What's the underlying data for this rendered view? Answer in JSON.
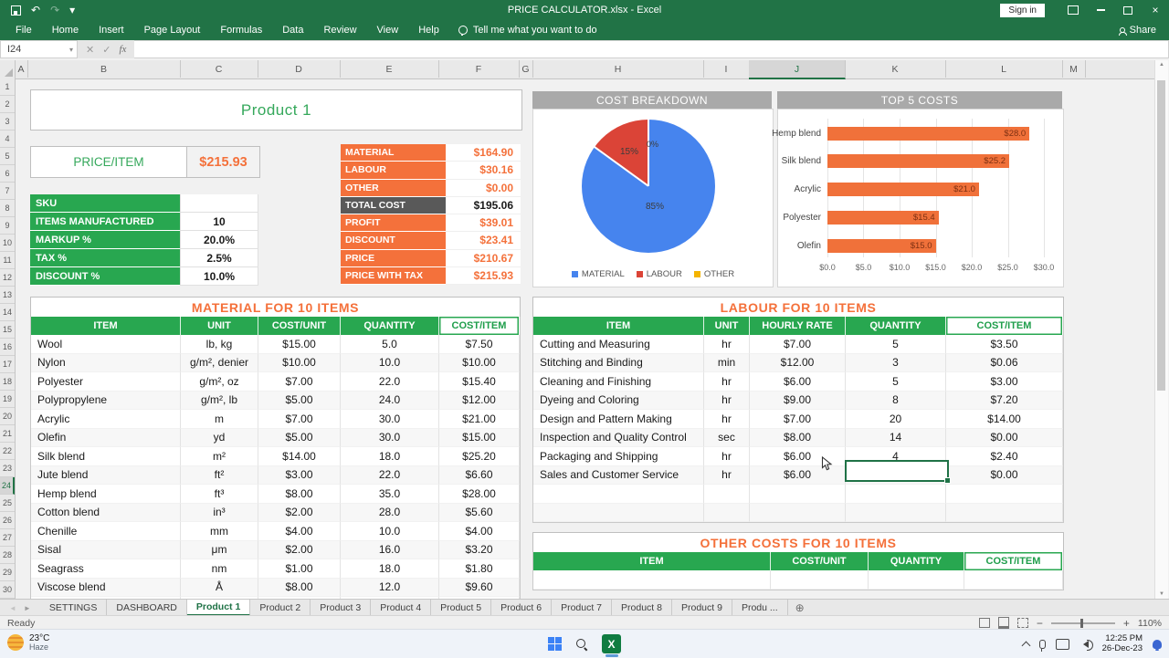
{
  "titlebar": {
    "title": "PRICE CALCULATOR.xlsx - Excel",
    "sign_in": "Sign in",
    "share": "Share"
  },
  "ribbon": {
    "tabs": [
      {
        "label": "File"
      },
      {
        "label": "Home"
      },
      {
        "label": "Insert"
      },
      {
        "label": "Page Layout"
      },
      {
        "label": "Formulas"
      },
      {
        "label": "Data"
      },
      {
        "label": "Review"
      },
      {
        "label": "View"
      },
      {
        "label": "Help"
      }
    ],
    "tell_me": "Tell me what you want to do"
  },
  "formula_bar": {
    "name_box": "I24",
    "fx": "fx"
  },
  "icons": {
    "undo": "↶",
    "redo": "↷",
    "dropdown": "▾",
    "close": "×",
    "check": "✓",
    "cancel": "✕",
    "up": "▲",
    "down": "▼",
    "prev": "◄",
    "next": "►",
    "new_sheet": "⊕",
    "minus": "−",
    "plus": "+"
  },
  "grid": {
    "columns": [
      {
        "label": "A"
      },
      {
        "label": "B"
      },
      {
        "label": "C"
      },
      {
        "label": "D"
      },
      {
        "label": "E"
      },
      {
        "label": "F"
      },
      {
        "label": "G"
      },
      {
        "label": "H"
      },
      {
        "label": "I"
      },
      {
        "label": "J",
        "class": "sel"
      },
      {
        "label": "K"
      },
      {
        "label": "L"
      },
      {
        "label": "M"
      }
    ],
    "rows": [
      {
        "label": "1"
      },
      {
        "label": "2"
      },
      {
        "label": "3"
      },
      {
        "label": "4"
      },
      {
        "label": "5"
      },
      {
        "label": "6"
      },
      {
        "label": "7"
      },
      {
        "label": "8"
      },
      {
        "label": "9"
      },
      {
        "label": "10"
      },
      {
        "label": "11"
      },
      {
        "label": "12"
      },
      {
        "label": "13"
      },
      {
        "label": "14"
      },
      {
        "label": "15"
      },
      {
        "label": "16"
      },
      {
        "label": "17"
      },
      {
        "label": "18"
      },
      {
        "label": "19"
      },
      {
        "label": "20"
      },
      {
        "label": "21"
      },
      {
        "label": "22"
      },
      {
        "label": "23"
      },
      {
        "label": "24",
        "class": "sel"
      },
      {
        "label": "25"
      },
      {
        "label": "26"
      },
      {
        "label": "27"
      },
      {
        "label": "28"
      },
      {
        "label": "29"
      },
      {
        "label": "30"
      }
    ]
  },
  "product": {
    "title": "Product 1",
    "price_label": "PRICE/ITEM",
    "price_value": "$215.93",
    "params": [
      {
        "label": "SKU",
        "value": ""
      },
      {
        "label": "ITEMS MANUFACTURED",
        "value": "10"
      },
      {
        "label": "MARKUP %",
        "value": "20.0%"
      },
      {
        "label": "TAX %",
        "value": "2.5%"
      },
      {
        "label": "DISCOUNT %",
        "value": "10.0%"
      }
    ]
  },
  "summary": {
    "rows": [
      {
        "label": "MATERIAL",
        "value": "$164.90"
      },
      {
        "label": "LABOUR",
        "value": "$30.16"
      },
      {
        "label": "OTHER",
        "value": "$0.00"
      },
      {
        "label": "TOTAL COST",
        "value": "$195.06",
        "class": "dark"
      },
      {
        "label": "PROFIT",
        "value": "$39.01"
      },
      {
        "label": "DISCOUNT",
        "value": "$23.41"
      },
      {
        "label": "PRICE",
        "value": "$210.67"
      },
      {
        "label": "PRICE WITH TAX",
        "value": "$215.93"
      }
    ]
  },
  "chart_data": [
    {
      "type": "pie",
      "title": "COST BREAKDOWN",
      "labels": [
        "MATERIAL",
        "LABOUR",
        "OTHER"
      ],
      "values": [
        85,
        15,
        0
      ],
      "value_labels": [
        "85%",
        "15%",
        "0%"
      ],
      "colors": [
        "#4684EE",
        "#DB4437",
        "#F4B400"
      ],
      "legend_position": "bottom"
    },
    {
      "type": "bar",
      "title": "TOP 5 COSTS",
      "orientation": "horizontal",
      "categories": [
        "Hemp blend",
        "Silk blend",
        "Acrylic",
        "Polyester",
        "Olefin"
      ],
      "values": [
        28.0,
        25.2,
        21.0,
        15.4,
        15.0
      ],
      "value_labels": [
        "$28.0",
        "$25.2",
        "$21.0",
        "$15.4",
        "$15.0"
      ],
      "xlim": [
        0,
        30
      ],
      "x_ticks": [
        "$0.0",
        "$5.0",
        "$10.0",
        "$15.0",
        "$20.0",
        "$25.0",
        "$30.0"
      ],
      "bar_color": "#F0713A",
      "grid": true
    }
  ],
  "tables": {
    "material": {
      "title": "MATERIAL FOR 10 ITEMS",
      "headers": [
        "ITEM",
        "UNIT",
        "COST/UNIT",
        "QUANTITY",
        "COST/ITEM"
      ],
      "calc_last": true,
      "empty_rows": 1,
      "rows": [
        [
          "Wool",
          "lb, kg",
          "$15.00",
          "5.0",
          "$7.50"
        ],
        [
          "Nylon",
          "g/m², denier",
          "$10.00",
          "10.0",
          "$10.00"
        ],
        [
          "Polyester",
          "g/m², oz",
          "$7.00",
          "22.0",
          "$15.40"
        ],
        [
          "Polypropylene",
          "g/m², lb",
          "$5.00",
          "24.0",
          "$12.00"
        ],
        [
          "Acrylic",
          "m",
          "$7.00",
          "30.0",
          "$21.00"
        ],
        [
          "Olefin",
          "yd",
          "$5.00",
          "30.0",
          "$15.00"
        ],
        [
          "Silk blend",
          "m²",
          "$14.00",
          "18.0",
          "$25.20"
        ],
        [
          "Jute blend",
          "ft²",
          "$3.00",
          "22.0",
          "$6.60"
        ],
        [
          "Hemp blend",
          "ft³",
          "$8.00",
          "35.0",
          "$28.00"
        ],
        [
          "Cotton blend",
          "in³",
          "$2.00",
          "28.0",
          "$5.60"
        ],
        [
          "Chenille",
          "mm",
          "$4.00",
          "10.0",
          "$4.00"
        ],
        [
          "Sisal",
          "μm",
          "$2.00",
          "16.0",
          "$3.20"
        ],
        [
          "Seagrass",
          "nm",
          "$1.00",
          "18.0",
          "$1.80"
        ],
        [
          "Viscose blend",
          "Å",
          "$8.00",
          "12.0",
          "$9.60"
        ]
      ]
    },
    "labour": {
      "title": "LABOUR FOR 10 ITEMS",
      "headers": [
        "ITEM",
        "UNIT",
        "HOURLY RATE",
        "QUANTITY",
        "COST/ITEM"
      ],
      "calc_last": true,
      "empty_rows": 2,
      "rows": [
        [
          "Cutting and Measuring",
          "hr",
          "$7.00",
          "5",
          "$3.50"
        ],
        [
          "Stitching and Binding",
          "min",
          "$12.00",
          "3",
          "$0.06"
        ],
        [
          "Cleaning and Finishing",
          "hr",
          "$6.00",
          "5",
          "$3.00"
        ],
        [
          "Dyeing and Coloring",
          "hr",
          "$9.00",
          "8",
          "$7.20"
        ],
        [
          "Design and Pattern Making",
          "hr",
          "$7.00",
          "20",
          "$14.00"
        ],
        [
          "Inspection and Quality Control",
          "sec",
          "$8.00",
          "14",
          "$0.00"
        ],
        [
          "Packaging and Shipping",
          "hr",
          "$6.00",
          "4",
          "$2.40"
        ],
        [
          "Sales and Customer Service",
          "hr",
          "$6.00",
          "",
          "$0.00"
        ]
      ]
    },
    "other": {
      "title": "OTHER COSTS FOR 10 ITEMS",
      "headers": [
        "ITEM",
        "COST/UNIT",
        "QUANTITY",
        "COST/ITEM"
      ],
      "calc_last": true,
      "empty_rows": 1,
      "rows": []
    }
  },
  "sheet_tabs": {
    "items": [
      {
        "label": "SETTINGS"
      },
      {
        "label": "DASHBOARD"
      },
      {
        "label": "Product 1",
        "class": "active"
      },
      {
        "label": "Product 2"
      },
      {
        "label": "Product 3"
      },
      {
        "label": "Product 4"
      },
      {
        "label": "Product 5"
      },
      {
        "label": "Product 6"
      },
      {
        "label": "Product 7"
      },
      {
        "label": "Product 8"
      },
      {
        "label": "Product 9"
      },
      {
        "label": "Produ ..."
      }
    ]
  },
  "status_bar": {
    "ready": "Ready",
    "zoom": "110%"
  },
  "taskbar": {
    "temp": "23°C",
    "condition": "Haze",
    "time": "12:25 PM",
    "date": "26-Dec-23"
  }
}
